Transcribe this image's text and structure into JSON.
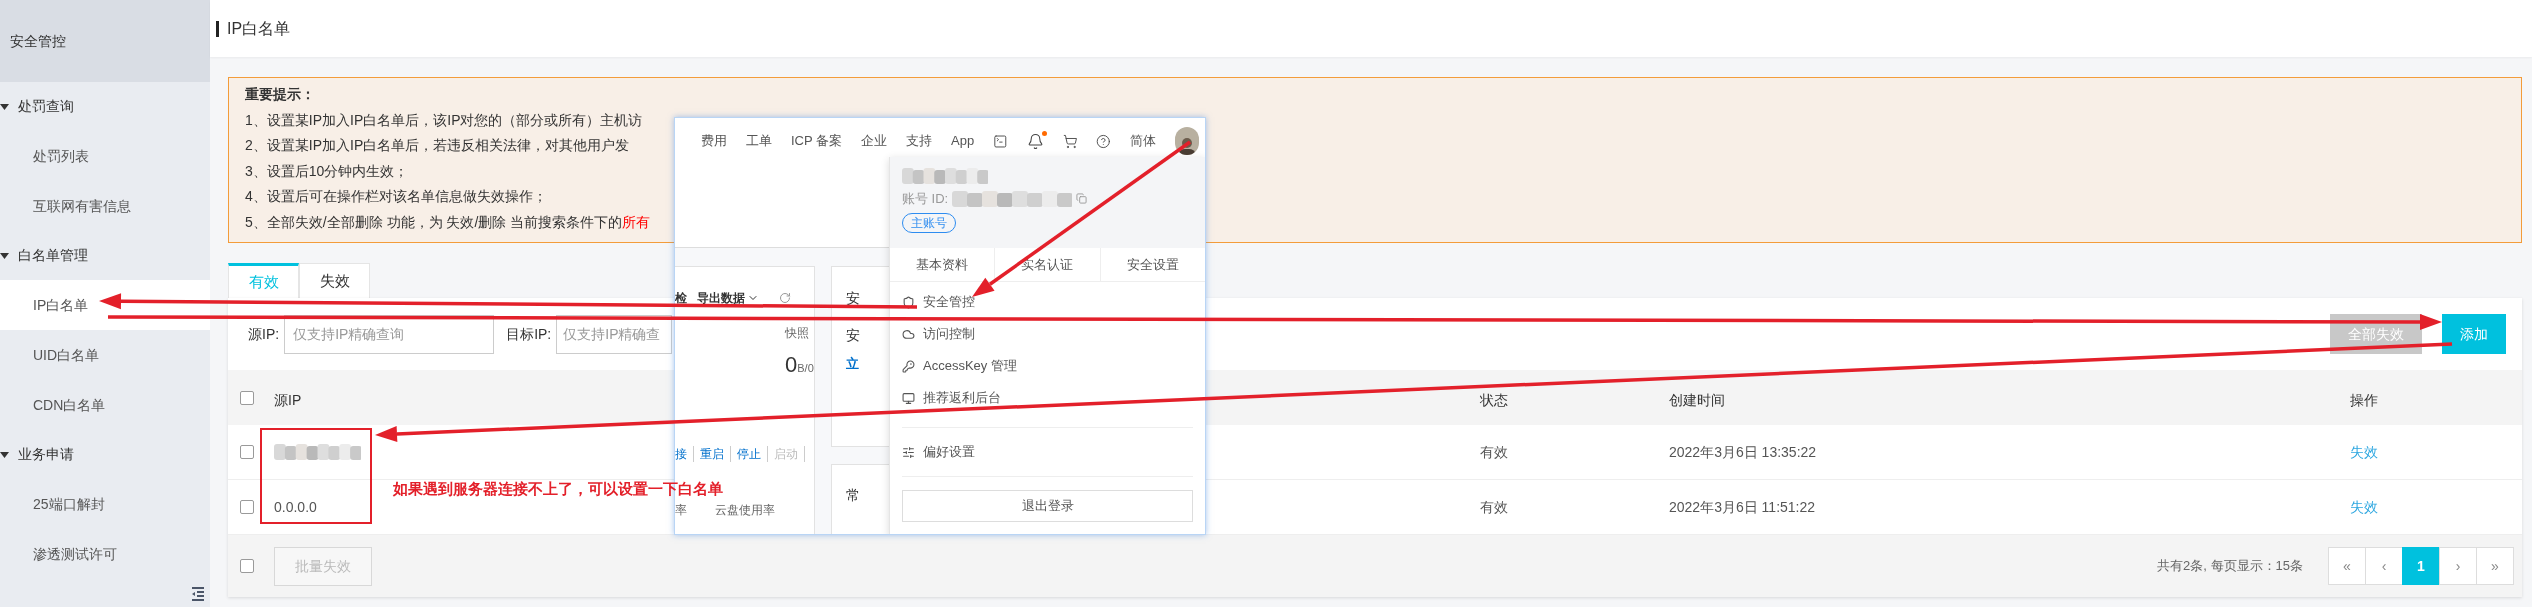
{
  "sidebar": {
    "title": "安全管控",
    "groups": [
      {
        "label": "处罚查询",
        "expanded": true,
        "items": [
          {
            "label": "处罚列表",
            "selected": false
          },
          {
            "label": "互联网有害信息",
            "selected": false
          }
        ]
      },
      {
        "label": "白名单管理",
        "expanded": true,
        "items": [
          {
            "label": "IP白名单",
            "selected": true
          },
          {
            "label": "UID白名单",
            "selected": false
          },
          {
            "label": "CDN白名单",
            "selected": false
          }
        ]
      },
      {
        "label": "业务申请",
        "expanded": true,
        "items": [
          {
            "label": "25端口解封",
            "selected": false
          },
          {
            "label": "渗透测试许可",
            "selected": false
          }
        ]
      }
    ]
  },
  "page_title": "IP白名单",
  "notice": {
    "title": "重要提示：",
    "lines": [
      {
        "text": "1、设置某IP加入IP白名单后，该IP对您的（部分或所有）主机访"
      },
      {
        "text": "2、设置某IP加入IP白名单后，若违反相关法律，对其他用户发"
      },
      {
        "text": "3、设置后10分钟内生效；"
      },
      {
        "text": "4、设置后可在操作栏对该名单信息做失效操作；"
      },
      {
        "text": "5、全部失效/全部删除 功能，为 失效/删除 当前搜索条件下的",
        "highlight": "所有"
      }
    ]
  },
  "tabs": [
    {
      "label": "有效",
      "selected": true
    },
    {
      "label": "失效",
      "selected": false
    }
  ],
  "filters": [
    {
      "label": "源IP:",
      "placeholder": "仅支持IP精确查询"
    },
    {
      "label": "目标IP:",
      "placeholder": "仅支持IP精确查"
    }
  ],
  "actions": [
    {
      "label": "全部失效",
      "disabled": true
    },
    {
      "label": "添加",
      "disabled": false
    }
  ],
  "table": {
    "header_checked": false,
    "columns": [
      "源IP",
      "状态",
      "创建时间",
      "操作"
    ],
    "rows": [
      {
        "checked": false,
        "redacted": true,
        "status": "有效",
        "created": "2022年3月6日 13:35:22",
        "action": "失效"
      },
      {
        "checked": false,
        "redacted": false,
        "source_ip": "0.0.0.0",
        "status": "有效",
        "created": "2022年3月6日 11:51:22",
        "action": "失效"
      }
    ]
  },
  "footer": {
    "checked": false,
    "batch": {
      "label": "批量失效",
      "disabled": true
    },
    "summary": "共有2条, 每页显示：15条",
    "pages": [
      {
        "label": "«",
        "selected": false
      },
      {
        "label": "‹",
        "selected": false
      },
      {
        "label": "1",
        "selected": true
      },
      {
        "label": "›",
        "selected": false
      },
      {
        "label": "»",
        "selected": false
      }
    ]
  },
  "overlay": {
    "nav": [
      "费用",
      "工单",
      "ICP 备案",
      "企业",
      "支持",
      "App"
    ],
    "notification_dot": true,
    "language": "简体",
    "account": {
      "id_label": "账号 ID:",
      "badge": "主账号",
      "tabs": [
        "基本资料",
        "实名认证",
        "安全设置"
      ],
      "menu": [
        "安全管控",
        "访问控制",
        "AccessKey 管理",
        "推荐返利后台"
      ],
      "preferences": "偏好设置",
      "logout": "退出登录"
    },
    "card1": {
      "cut_label": "检",
      "export": "导出数据",
      "snapshot": "快照",
      "value": "0",
      "unit": "B/0",
      "links": [
        {
          "label": "接",
          "disabled": false
        },
        {
          "label": "重启",
          "disabled": false
        },
        {
          "label": "停止",
          "disabled": false
        },
        {
          "label": "启动",
          "disabled": true
        }
      ],
      "metrics": [
        "率",
        "云盘使用率"
      ]
    },
    "card2": {
      "lines": [
        "安",
        "安"
      ],
      "link": "立"
    },
    "card3": {
      "title": "常"
    }
  },
  "annotation": {
    "note": "如果遇到服务器连接不上了，可以设置一下白名单"
  }
}
